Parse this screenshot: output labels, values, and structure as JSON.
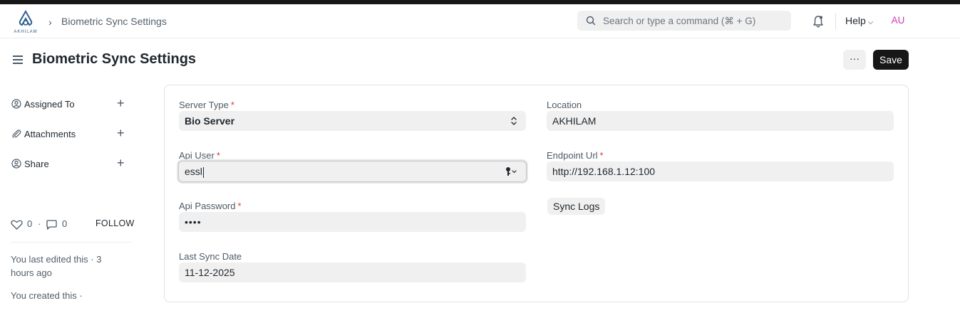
{
  "navbar": {
    "logo_text": "AKHILAM",
    "breadcrumb": "Biometric Sync Settings",
    "search_placeholder": "Search or type a command (⌘ + G)",
    "help_label": "Help",
    "avatar_initials": "AU",
    "avatar_color": "#cb3bb3"
  },
  "page": {
    "title": "Biometric Sync Settings",
    "more_label": "···",
    "save_label": "Save"
  },
  "sidebar": {
    "items": [
      {
        "label": "Assigned To",
        "icon": "assign-user-icon"
      },
      {
        "label": "Attachments",
        "icon": "paperclip-icon"
      },
      {
        "label": "Share",
        "icon": "share-user-icon"
      }
    ],
    "like_count": "0",
    "comment_count": "0",
    "separator": "·",
    "follow_label": "FOLLOW",
    "last_edited": "You last edited this · 3 hours ago",
    "created": "You created this ·"
  },
  "form": {
    "server_type": {
      "label": "Server Type",
      "value": "Bio Server",
      "required": true
    },
    "api_user": {
      "label": "Api User",
      "value": "essl",
      "required": true
    },
    "api_password": {
      "label": "Api Password",
      "value": "••••",
      "required": true
    },
    "last_sync_date": {
      "label": "Last Sync Date",
      "value": "11-12-2025"
    },
    "location": {
      "label": "Location",
      "value": "AKHILAM"
    },
    "endpoint_url": {
      "label": "Endpoint Url",
      "value": "http://192.168.1.12:100",
      "required": true
    },
    "sync_logs_label": "Sync Logs",
    "required_mark": "*"
  },
  "colors": {
    "accent": "#171717",
    "required": "#e03636",
    "field_bg": "#f0f0f0"
  }
}
